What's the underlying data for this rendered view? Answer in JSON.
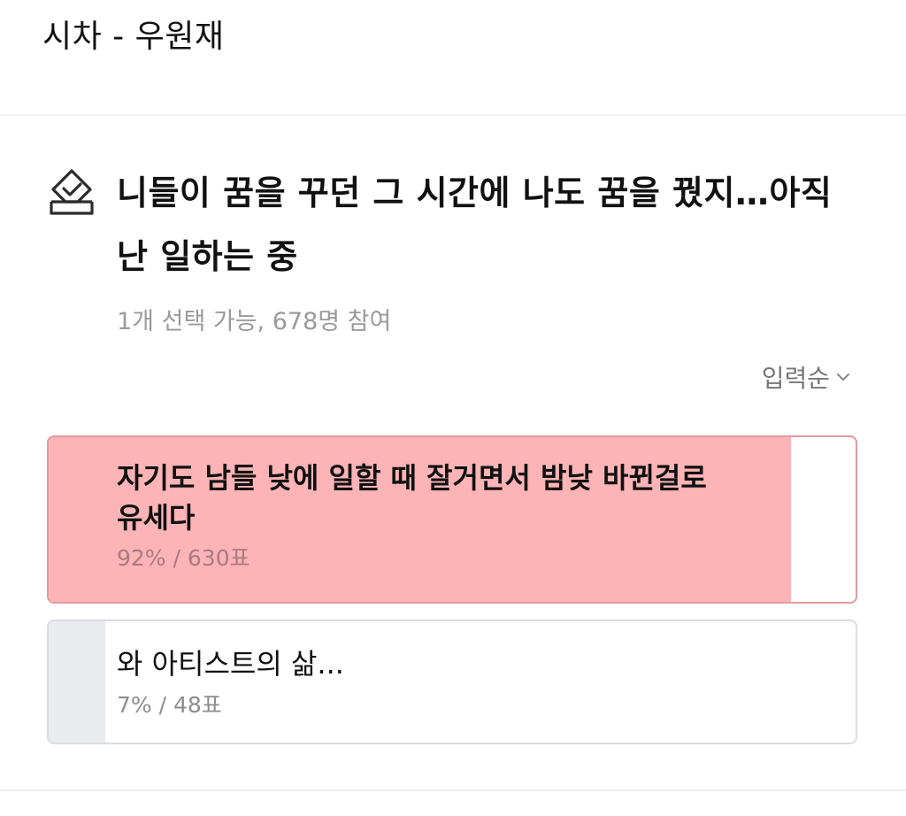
{
  "header": {
    "title": "시차 - 우원재"
  },
  "poll": {
    "icon": "ballot-check-icon",
    "question": "니들이 꿈을 꾸던 그 시간에 나도 꿈을 꿨지…아직 난 일하는 중",
    "meta": "1개 선택 가능, 678명 참여",
    "sort": {
      "label": "입력순",
      "icon": "chevron-down-icon"
    },
    "options": [
      {
        "text": "자기도 남들 낮에 일할 때 잘거면서 밤낮 바뀐걸로 유세다",
        "stats": "92% / 630표",
        "fill_fraction": 0.92,
        "fill_color": "#fdb4b6",
        "selected": true
      },
      {
        "text": "와 아티스트의 삶...",
        "stats": "7% / 48표",
        "fill_fraction": 0.07,
        "fill_color": "#e9ebef",
        "selected": false
      }
    ]
  },
  "colors": {
    "accent": "#fdb4b6",
    "muted_text": "#9a9a9a",
    "border": "#dcdcdc"
  }
}
